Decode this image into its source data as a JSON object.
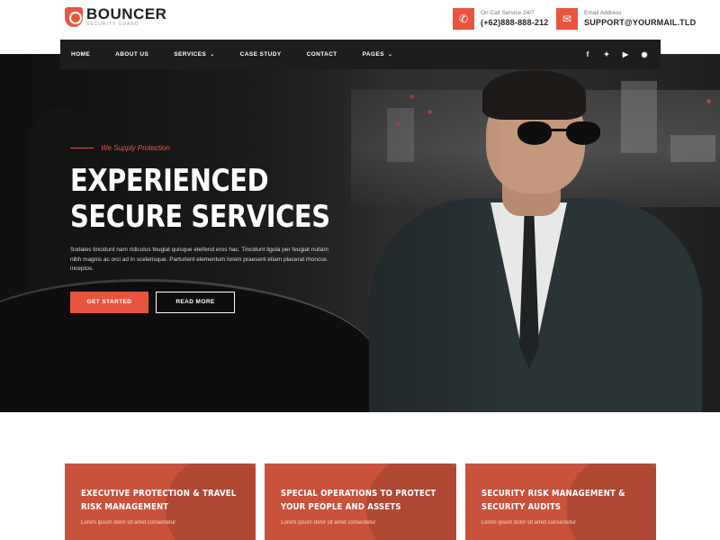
{
  "brand": {
    "name": "BOUNCER",
    "tagline": "SECURITY GUARD",
    "accent": "#e8553e"
  },
  "contacts": [
    {
      "icon": "phone-icon",
      "label": "On Call Service 24/7",
      "value": "(+62)888-888-212"
    },
    {
      "icon": "envelope-icon",
      "label": "Email Address",
      "value": "SUPPORT@YOURMAIL.TLD"
    }
  ],
  "nav": {
    "items": [
      {
        "label": "HOME",
        "has_dropdown": false
      },
      {
        "label": "ABOUT US",
        "has_dropdown": false
      },
      {
        "label": "SERVICES",
        "has_dropdown": true
      },
      {
        "label": "CASE STUDY",
        "has_dropdown": false
      },
      {
        "label": "CONTACT",
        "has_dropdown": false
      },
      {
        "label": "PAGES",
        "has_dropdown": true
      }
    ],
    "social": [
      "facebook-icon",
      "twitter-icon",
      "youtube-icon",
      "instagram-icon"
    ]
  },
  "hero": {
    "eyebrow": "We Supply Protection",
    "headline": "EXPERIENCED SECURE SERVICES",
    "description": "Sodales tincidunt nam ridiculus feugiat quisque eleifend eros hac. Tincidunt ligula per feugiat nullam nibh magnis ac orci ad in scelerisque. Parturient elementum lorem praesent etiam placerat rhoncus inceptos.",
    "primary_button": "GET STARTED",
    "secondary_button": "READ MORE"
  },
  "services": [
    {
      "title": "EXECUTIVE PROTECTION & TRAVEL RISK MANAGEMENT",
      "text": "Lorem ipsum dolor sit amet consectetur"
    },
    {
      "title": "SPECIAL OPERATIONS TO PROTECT YOUR PEOPLE AND ASSETS",
      "text": "Lorem ipsum dolor sit amet consectetur"
    },
    {
      "title": "SECURITY RISK MANAGEMENT & SECURITY AUDITS",
      "text": "Lorem ipsum dolor sit amet consectetur"
    }
  ]
}
